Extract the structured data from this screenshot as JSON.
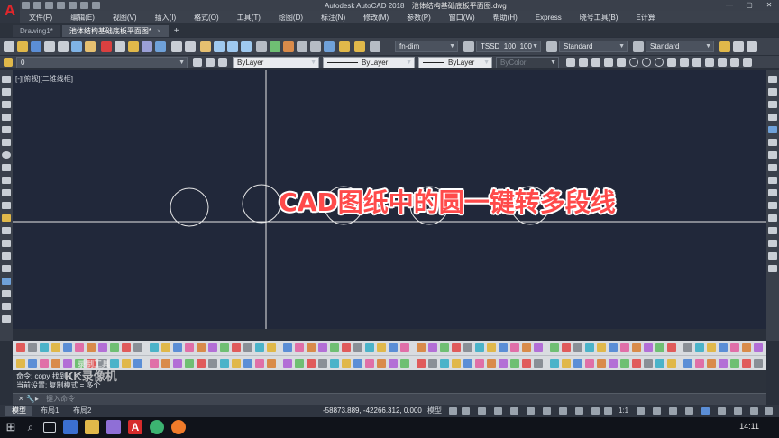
{
  "titlebar": {
    "app_title": "Autodesk AutoCAD 2018",
    "document_title": "池体结构基础底板平面图.dwg",
    "window_buttons": [
      "—",
      "▢",
      "✕"
    ]
  },
  "menu": [
    "文件(F)",
    "编辑(E)",
    "视图(V)",
    "插入(I)",
    "格式(O)",
    "工具(T)",
    "绘图(D)",
    "标注(N)",
    "修改(M)",
    "参数(P)",
    "窗口(W)",
    "帮助(H)",
    "Express",
    "晓号工具(B)",
    "E计算"
  ],
  "tabs": [
    {
      "label": "Drawing1*",
      "active": false
    },
    {
      "label": "池体结构基础底板平面图*",
      "active": true
    }
  ],
  "toolbar": {
    "dimstyle": "fn-dim",
    "textstyle": "TSSD_100_100",
    "tablestyle": "Standard",
    "mleaderstyle": "Standard"
  },
  "properties_bar": {
    "layer": "0",
    "color": "ByLayer",
    "linetype": "ByLayer",
    "lineweight": "ByLayer",
    "plotstyle": "ByColor"
  },
  "canvas": {
    "view_label": "[-][俯视][二维线框]",
    "overlay_caption": "CAD图纸中的圆一键转多段线",
    "background": "#21283a",
    "line_color": "#e6e6e6"
  },
  "command": {
    "history_line1": "命令:  copy  找到 1 个",
    "history_line2": "当前设置:   复制模式 = 多个",
    "prompt_placeholder": "键入命令"
  },
  "watermark": {
    "line1": "KK录像机",
    "line2": "录制工具"
  },
  "layout_tabs": [
    "模型",
    "布局1",
    "布局2"
  ],
  "status": {
    "coordinates": "-58873.889, -42266.312, 0.000",
    "model_label": "模型",
    "scale": "1:1"
  },
  "taskbar": {
    "time": "14:11"
  },
  "colors": {
    "accent_red": "#e0262b",
    "caption_red": "#ff4a4a"
  }
}
